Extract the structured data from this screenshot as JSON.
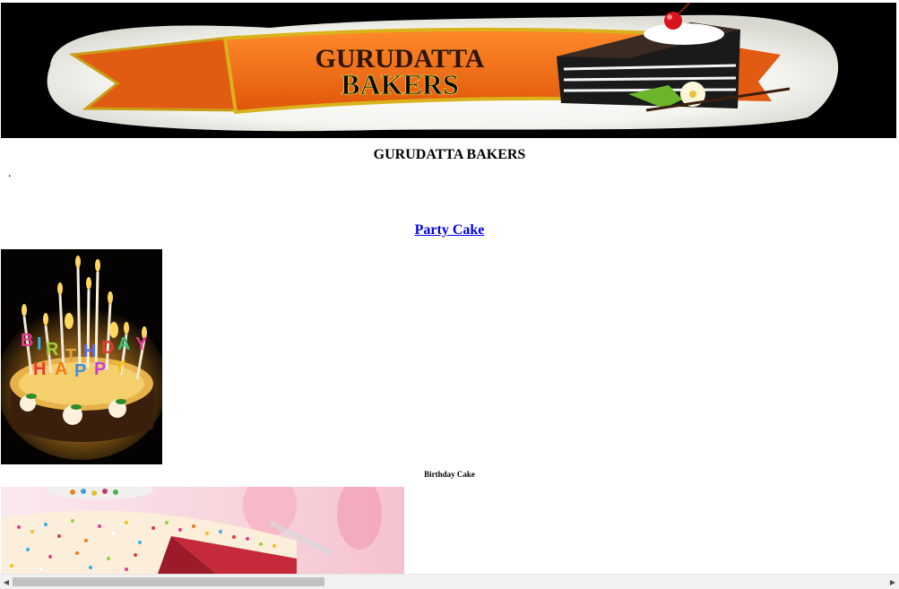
{
  "banner": {
    "line1": "GURUDATTA",
    "line2": "BAKERS"
  },
  "page": {
    "title": "GURUDATTA BAKERS",
    "dot": "."
  },
  "category": {
    "link_label": "Party Cake"
  },
  "products": [
    {
      "caption": "Birthday Cake",
      "image_alt": "Birthday cake with lit candles"
    },
    {
      "image_alt": "Cake with colorful sprinkles"
    }
  ],
  "colors": {
    "link": "#0000ee",
    "banner_orange": "#f26a12",
    "banner_gold": "#e8c21a"
  }
}
